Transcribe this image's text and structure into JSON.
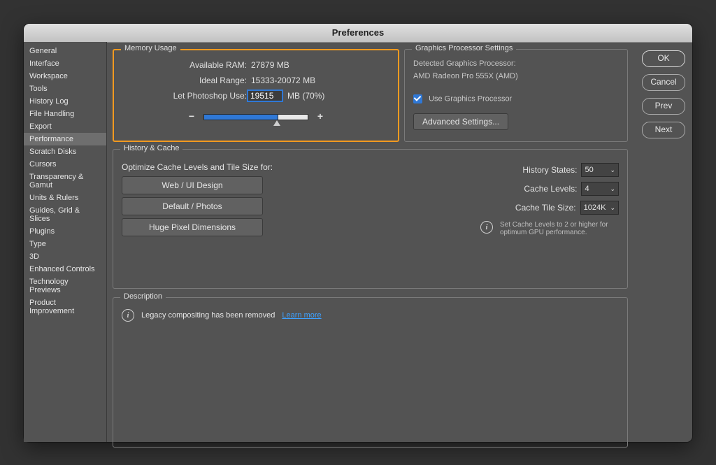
{
  "title": "Preferences",
  "buttons": {
    "ok": "OK",
    "cancel": "Cancel",
    "prev": "Prev",
    "next": "Next"
  },
  "sidebar": {
    "items": [
      "General",
      "Interface",
      "Workspace",
      "Tools",
      "History Log",
      "File Handling",
      "Export",
      "Performance",
      "Scratch Disks",
      "Cursors",
      "Transparency & Gamut",
      "Units & Rulers",
      "Guides, Grid & Slices",
      "Plugins",
      "Type",
      "3D",
      "Enhanced Controls",
      "Technology Previews",
      "Product Improvement"
    ],
    "selected": "Performance"
  },
  "memory": {
    "legend": "Memory Usage",
    "available_label": "Available RAM:",
    "available_value": "27879 MB",
    "ideal_label": "Ideal Range:",
    "ideal_value": "15333-20072 MB",
    "use_label": "Let Photoshop Use:",
    "use_value": "19515",
    "use_suffix": "MB (70%)",
    "slider_percent": 70,
    "minus": "−",
    "plus": "+"
  },
  "gps": {
    "legend": "Graphics Processor Settings",
    "detected_label": "Detected Graphics Processor:",
    "detected_value": "AMD Radeon Pro 555X (AMD)",
    "use_label": "Use Graphics Processor",
    "adv": "Advanced Settings..."
  },
  "hc": {
    "legend": "History & Cache",
    "optimize_label": "Optimize Cache Levels and Tile Size for:",
    "presets": [
      "Web / UI Design",
      "Default / Photos",
      "Huge Pixel Dimensions"
    ],
    "history_label": "History States:",
    "history_value": "50",
    "levels_label": "Cache Levels:",
    "levels_value": "4",
    "tile_label": "Cache Tile Size:",
    "tile_value": "1024K",
    "tip": "Set Cache Levels to 2 or higher for optimum GPU performance."
  },
  "legacy": {
    "text": "Legacy compositing has been removed",
    "link": "Learn more"
  },
  "desc": {
    "legend": "Description"
  }
}
